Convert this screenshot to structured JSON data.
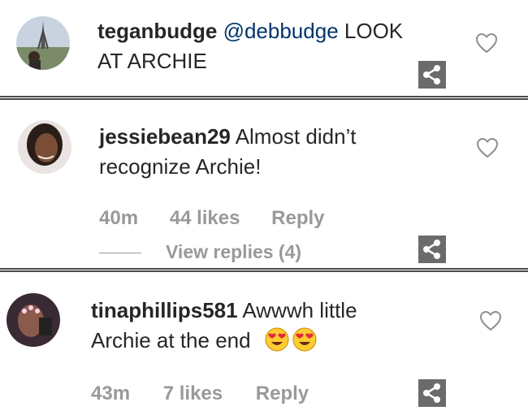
{
  "comments": [
    {
      "username": "teganbudge",
      "mention": "@debbudge",
      "text": "LOOK AT ARCHIE",
      "line2": "AT ARCHIE",
      "line1_rest": "LOOK"
    },
    {
      "username": "jessiebean29",
      "line1_text": "Almost didn’t",
      "line2": "recognize Archie!",
      "time": "40m",
      "likes": "44 likes",
      "reply": "Reply",
      "view_replies": "View replies (4)"
    },
    {
      "username": "tinaphillips581",
      "line1_text": "Awwwh little",
      "line2": "Archie at the end",
      "emojis": [
        "heart-eyes-emoji",
        "heart-eyes-emoji"
      ],
      "time": "43m",
      "likes": "7 likes",
      "reply": "Reply"
    }
  ],
  "icons": {
    "like": "heart-outline-icon",
    "share": "share-icon"
  },
  "colors": {
    "text": "#262626",
    "mention": "#003569",
    "meta": "#999999",
    "share_bg": "#6b6b6b",
    "separator": "#4a4a4a"
  }
}
